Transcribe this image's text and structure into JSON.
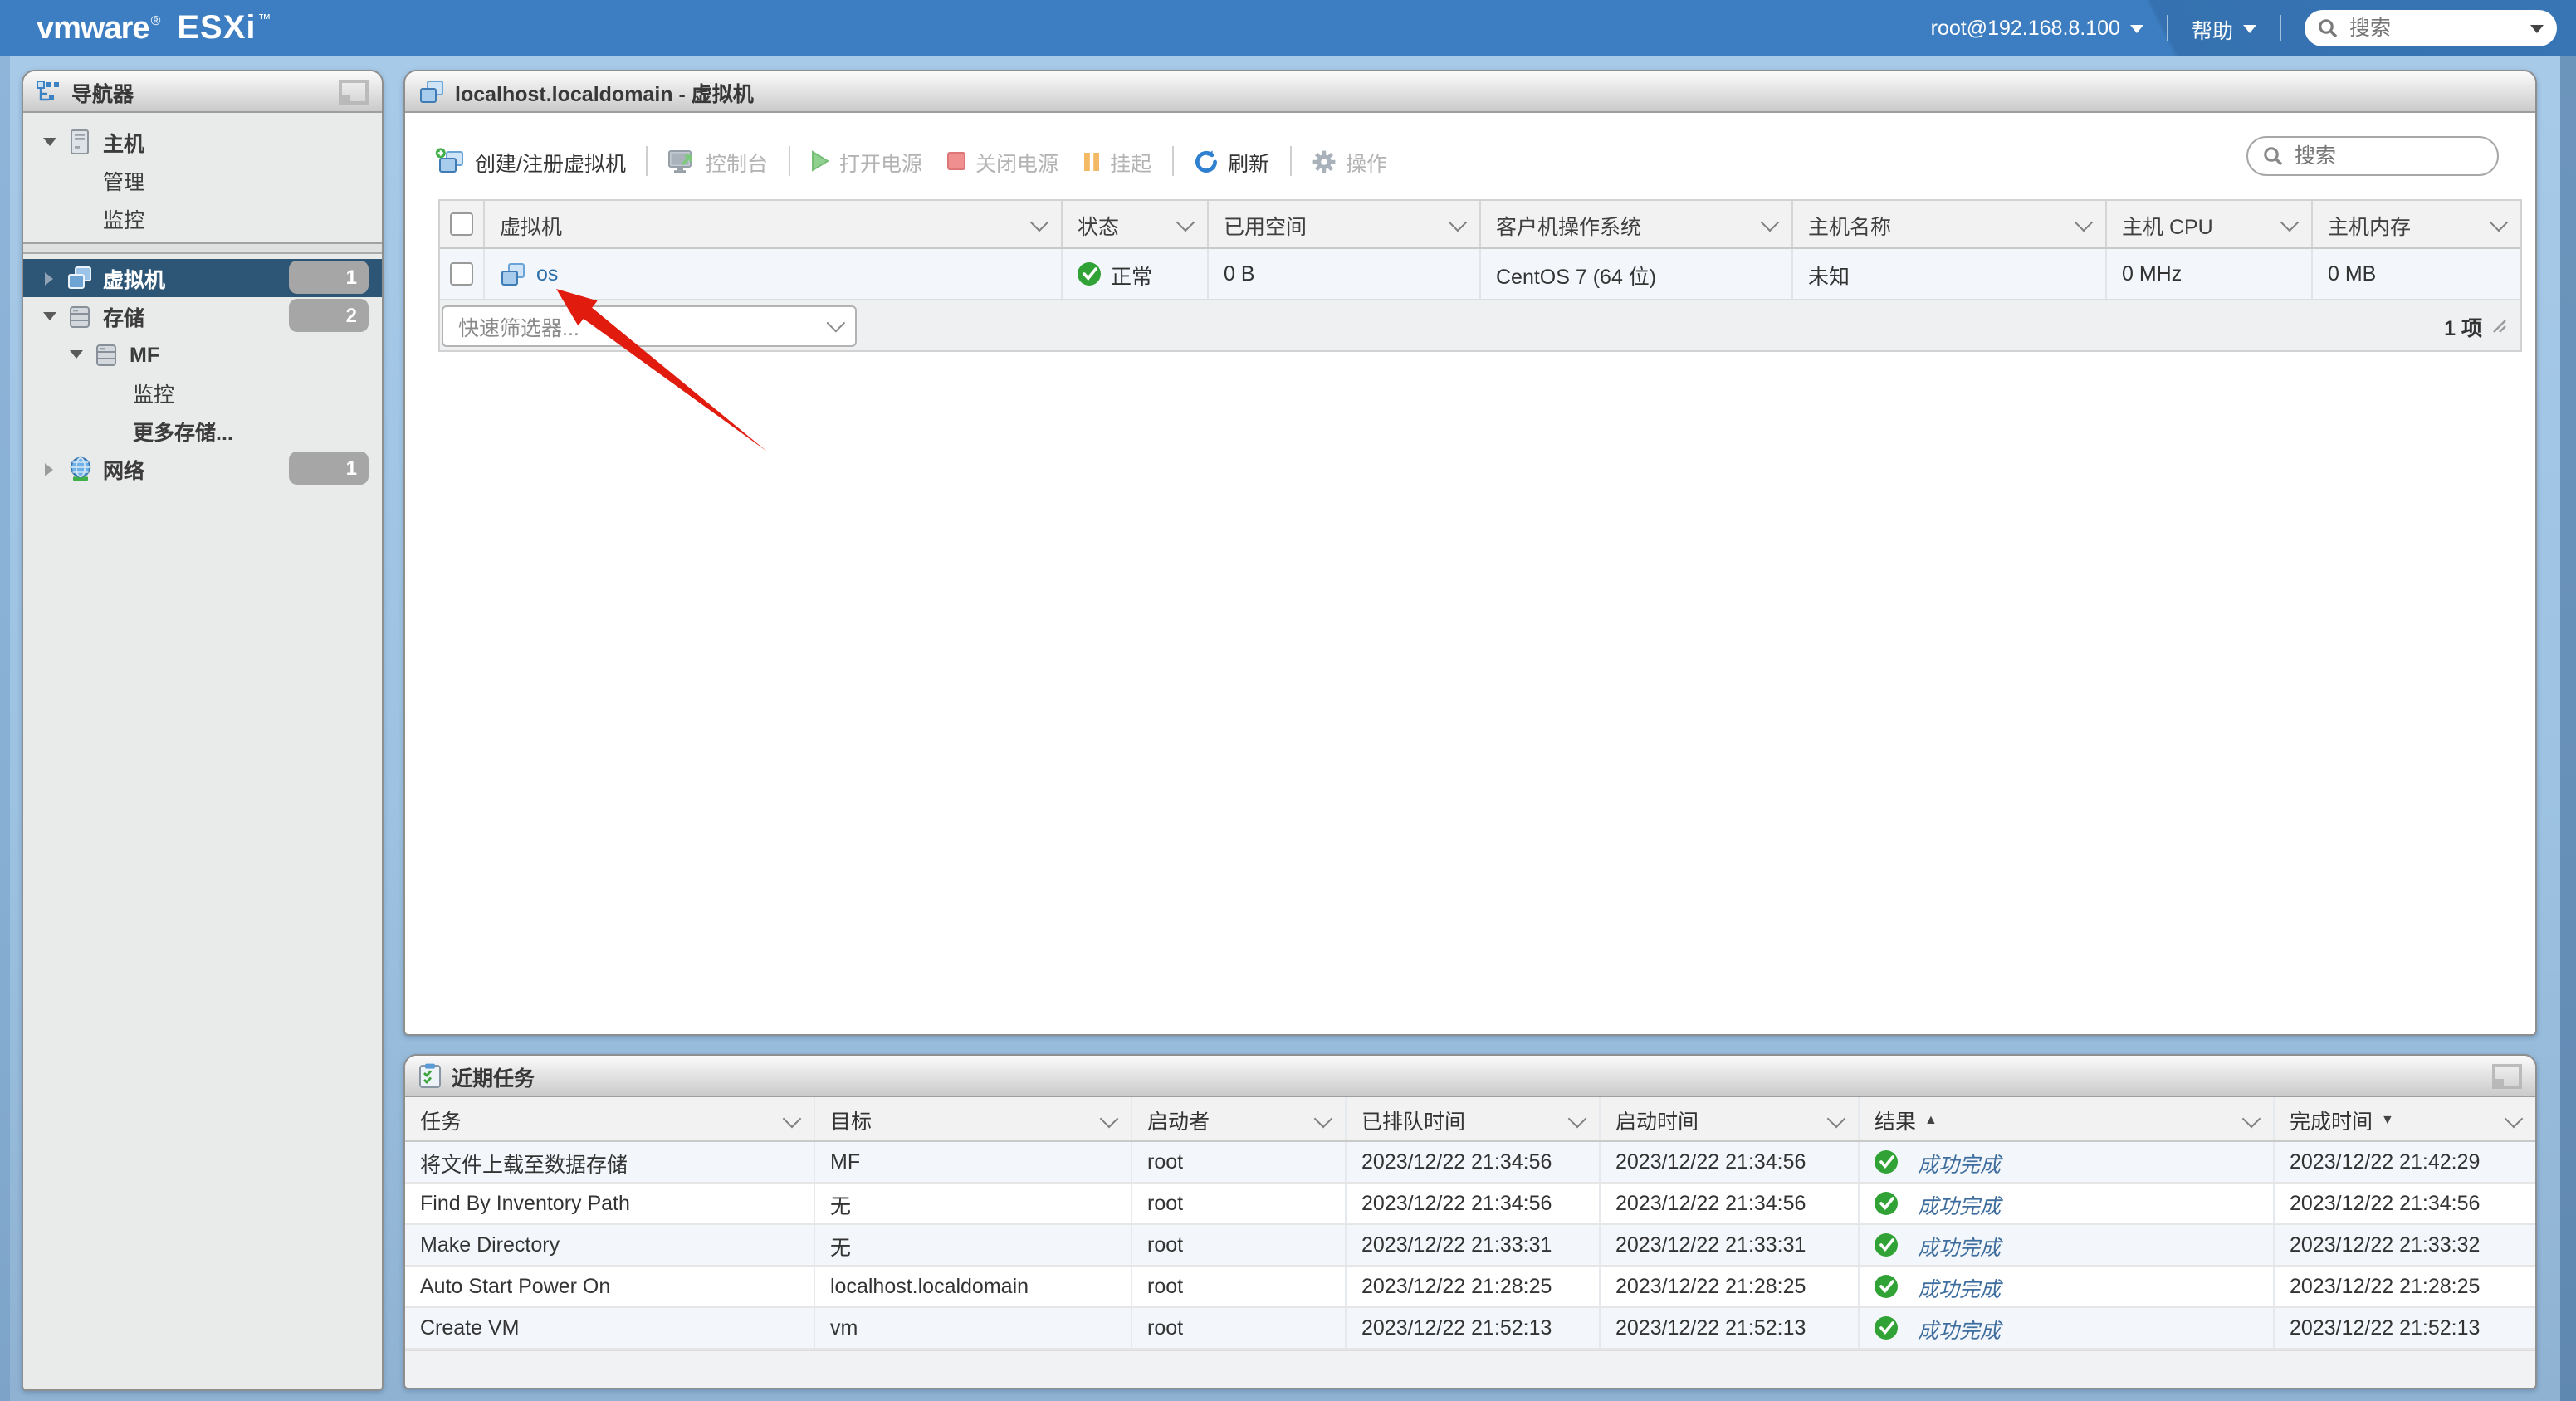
{
  "colors": {
    "topbar_blue": "#3c7ec1",
    "frame_light_blue": "#9dc2e2",
    "frame_dark_blue": "#24507f",
    "nav_selected_bg": "#2d5575",
    "link_blue": "#2b6da8",
    "success_green": "#31a336",
    "annotation_arrow_red": "#e11c0f"
  },
  "topbar": {
    "logo": {
      "vmware": "vmware",
      "reg": "®",
      "esxi": "ESXi",
      "tm": "™"
    },
    "user": "root@192.168.8.100",
    "help_label": "帮助",
    "search_placeholder": "搜索"
  },
  "navigator": {
    "title": "导航器",
    "items": [
      {
        "label": "主机"
      },
      {
        "label": "管理"
      },
      {
        "label": "监控"
      },
      {
        "label": "虚拟机",
        "badge": "1"
      },
      {
        "label": "存储",
        "badge": "2"
      },
      {
        "label": "MF"
      },
      {
        "label": "监控"
      },
      {
        "label": "更多存储..."
      },
      {
        "label": "网络",
        "badge": "1"
      }
    ]
  },
  "main": {
    "title": "localhost.localdomain - 虚拟机",
    "toolbar": [
      {
        "label": "创建/注册虚拟机",
        "enabled": true
      },
      {
        "label": "控制台",
        "enabled": false
      },
      {
        "label": "打开电源",
        "enabled": false
      },
      {
        "label": "关闭电源",
        "enabled": false
      },
      {
        "label": "挂起",
        "enabled": false
      },
      {
        "label": "刷新",
        "enabled": true
      },
      {
        "label": "操作",
        "enabled": false
      }
    ],
    "search_placeholder": "搜索",
    "columns": [
      "虚拟机",
      "状态",
      "已用空间",
      "客户机操作系统",
      "主机名称",
      "主机 CPU",
      "主机内存"
    ],
    "rows": [
      {
        "name": "os",
        "status": "正常",
        "used": "0 B",
        "guest_os": "CentOS 7 (64 位)",
        "host_name": "未知",
        "host_cpu": "0 MHz",
        "host_mem": "0 MB"
      }
    ],
    "filter_placeholder": "快速筛选器...",
    "count_label": "1 项"
  },
  "tasks": {
    "title": "近期任务",
    "columns": [
      "任务",
      "目标",
      "启动者",
      "已排队时间",
      "启动时间",
      "结果",
      "完成时间"
    ],
    "sort_asc": "▲",
    "sort_desc": "▼",
    "rows": [
      {
        "task": "将文件上载至数据存储",
        "target": "MF",
        "initiator": "root",
        "queued": "2023/12/22 21:34:56",
        "started": "2023/12/22 21:34:56",
        "result": "成功完成",
        "completed": "2023/12/22 21:42:29"
      },
      {
        "task": "Find By Inventory Path",
        "target": "无",
        "initiator": "root",
        "queued": "2023/12/22 21:34:56",
        "started": "2023/12/22 21:34:56",
        "result": "成功完成",
        "completed": "2023/12/22 21:34:56"
      },
      {
        "task": "Make Directory",
        "target": "无",
        "initiator": "root",
        "queued": "2023/12/22 21:33:31",
        "started": "2023/12/22 21:33:31",
        "result": "成功完成",
        "completed": "2023/12/22 21:33:32"
      },
      {
        "task": "Auto Start Power On",
        "target": "localhost.localdomain",
        "initiator": "root",
        "queued": "2023/12/22 21:28:25",
        "started": "2023/12/22 21:28:25",
        "result": "成功完成",
        "completed": "2023/12/22 21:28:25"
      },
      {
        "task": "Create VM",
        "target": "vm",
        "initiator": "root",
        "queued": "2023/12/22 21:52:13",
        "started": "2023/12/22 21:52:13",
        "result": "成功完成",
        "completed": "2023/12/22 21:52:13"
      }
    ]
  }
}
